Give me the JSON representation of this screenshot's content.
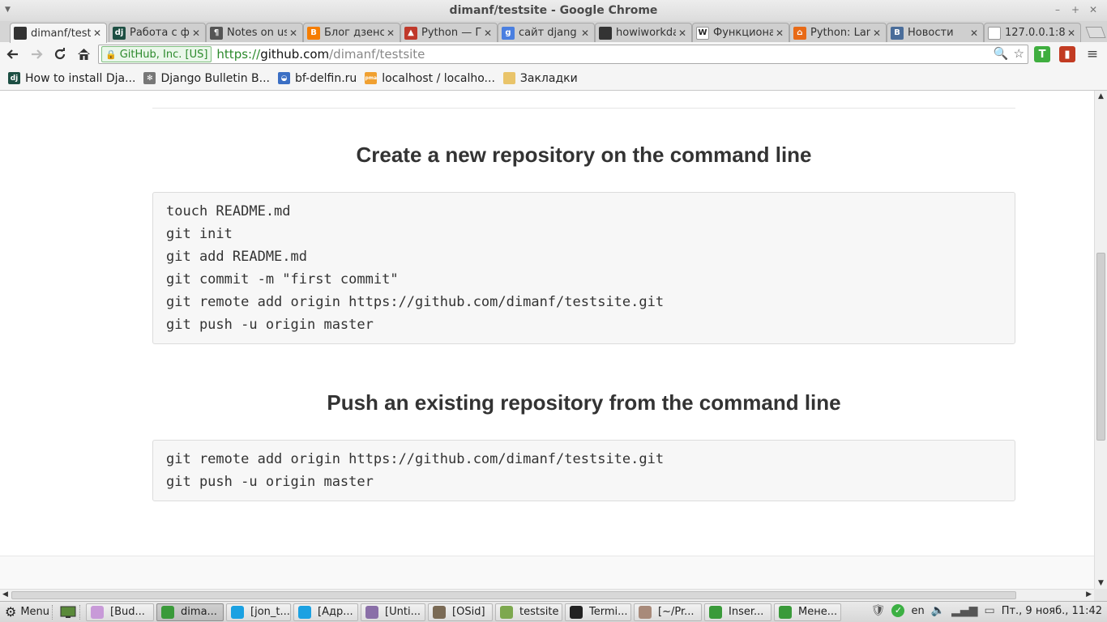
{
  "window": {
    "title": "dimanf/testsite - Google Chrome"
  },
  "tabs": [
    {
      "label": "dimanf/test",
      "icon": "github-icon",
      "color": "#333333",
      "glyph": "",
      "active": true
    },
    {
      "label": "Работа с фс",
      "icon": "django-icon",
      "color": "#1d4f43",
      "glyph": "dj",
      "active": false
    },
    {
      "label": "Notes on us",
      "icon": "docs-icon",
      "color": "#555555",
      "glyph": "¶",
      "active": false
    },
    {
      "label": "Блог дзенс",
      "icon": "blogger-icon",
      "color": "#f57d00",
      "glyph": "B",
      "active": false
    },
    {
      "label": "Python — Г",
      "icon": "python-icon",
      "color": "#c0392b",
      "glyph": "▲",
      "active": false
    },
    {
      "label": "сайт djang",
      "icon": "google-icon",
      "color": "#4a7fe0",
      "glyph": "g",
      "active": false
    },
    {
      "label": "howiworkda",
      "icon": "github-icon",
      "color": "#333333",
      "glyph": "",
      "active": false
    },
    {
      "label": "Функциона",
      "icon": "wikipedia-icon",
      "color": "#ffffff",
      "glyph": "W",
      "active": false
    },
    {
      "label": "Python: Lan",
      "icon": "home-icon",
      "color": "#e86a17",
      "glyph": "⌂",
      "active": false
    },
    {
      "label": "Новости",
      "icon": "vk-icon",
      "color": "#4a6d9a",
      "glyph": "B",
      "active": false
    },
    {
      "label": "127.0.0.1:8",
      "icon": "page-icon",
      "color": "#ffffff",
      "glyph": "",
      "active": false
    }
  ],
  "toolbar": {
    "ev_label": "GitHub, Inc. [US]",
    "url_scheme": "https://",
    "url_host": "github.com",
    "url_path": "/dimanf/testsite"
  },
  "bookmarks": [
    {
      "label": "How to install Dja...",
      "icon": "django-icon",
      "color": "#1d4f43",
      "glyph": "dj"
    },
    {
      "label": "Django Bulletin B...",
      "icon": "bulletin-icon",
      "color": "#777777",
      "glyph": "✻"
    },
    {
      "label": "bf-delfin.ru",
      "icon": "delfin-icon",
      "color": "#3b6fc4",
      "glyph": "◒"
    },
    {
      "label": "localhost / localho...",
      "icon": "phpmyadmin-icon",
      "color": "#f0a030",
      "glyph": "pma"
    },
    {
      "label": "Закладки",
      "icon": "folder-icon",
      "color": "#e9c46a",
      "glyph": ""
    }
  ],
  "content": {
    "create_heading": "Create a new repository on the command line",
    "create_lines": [
      "touch README.md",
      "git init",
      "git add README.md",
      "git commit -m \"first commit\"",
      "git remote add origin https://github.com/dimanf/testsite.git",
      "git push -u origin master"
    ],
    "push_heading": "Push an existing repository from the command line",
    "push_lines": [
      "git remote add origin https://github.com/dimanf/testsite.git",
      "git push -u origin master"
    ]
  },
  "taskbar": {
    "menu_label": "Menu",
    "tasks": [
      {
        "label": "[Bud...",
        "icon": "budgie-icon",
        "color": "#c89ad8",
        "active": false
      },
      {
        "label": "dima...",
        "icon": "chrome-icon",
        "color": "#3a9a3a",
        "active": true
      },
      {
        "label": "[jon_t...",
        "icon": "skype-icon",
        "color": "#1ba1e2",
        "active": false
      },
      {
        "label": "[Адр...",
        "icon": "skype-icon",
        "color": "#1ba1e2",
        "active": false
      },
      {
        "label": "[Unti...",
        "icon": "editor-icon",
        "color": "#8a6fa8",
        "active": false
      },
      {
        "label": "[OSid]",
        "icon": "gimp-icon",
        "color": "#7a6a55",
        "active": false
      },
      {
        "label": "testsite",
        "icon": "folder-icon",
        "color": "#7da84f",
        "active": false
      },
      {
        "label": "Termi...",
        "icon": "terminal-icon",
        "color": "#222222",
        "active": false
      },
      {
        "label": "[~/Pr...",
        "icon": "text-editor-icon",
        "color": "#a88a7a",
        "active": false
      },
      {
        "label": "Inser...",
        "icon": "chrome-icon",
        "color": "#3a9a3a",
        "active": false
      },
      {
        "label": "Мене...",
        "icon": "chrome-icon",
        "color": "#3a9a3a",
        "active": false
      }
    ],
    "lang": "en",
    "clock": "Пт., 9 нояб., 11:42"
  }
}
